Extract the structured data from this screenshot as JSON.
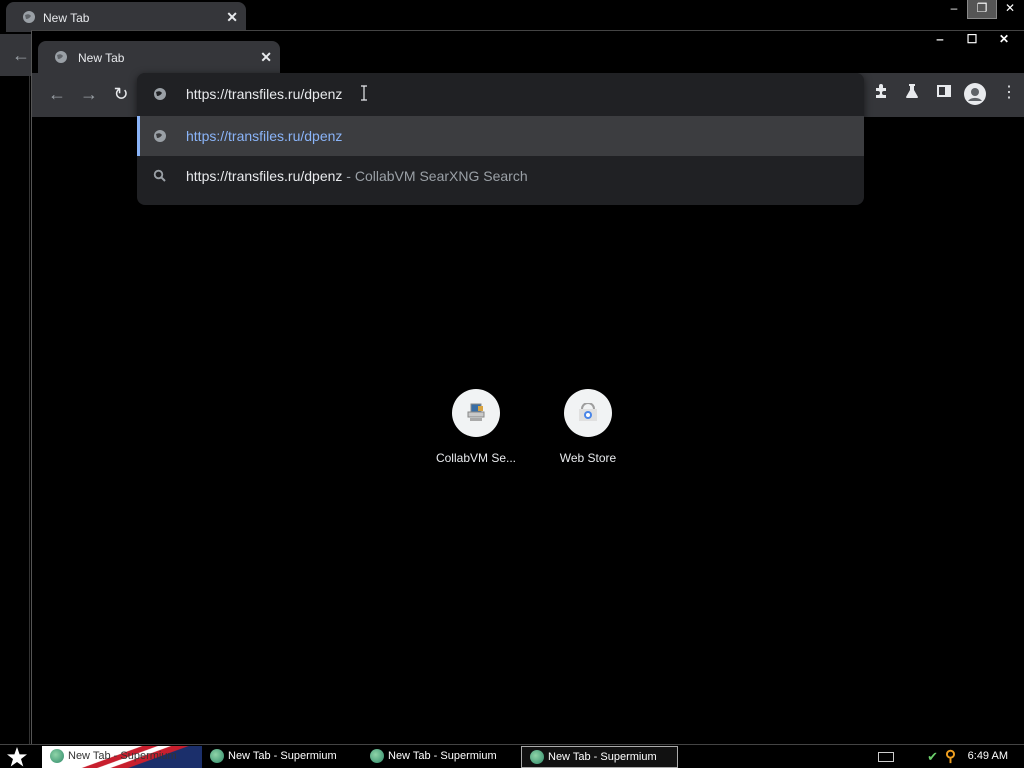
{
  "background_window": {
    "tab_title": "New Tab",
    "tab_close": "✕",
    "controls": {
      "minimize": "‒",
      "restore": "❐",
      "close": "✕"
    }
  },
  "window": {
    "tab_title": "New Tab",
    "tab_close": "✕",
    "controls": {
      "minimize": "‒",
      "maximize": "☐",
      "close": "✕"
    }
  },
  "toolbar": {
    "back": "←",
    "forward": "→",
    "reload": "↻",
    "extensions": "puzzle-icon",
    "labs": "flask-icon",
    "side_panel": "side-panel-icon",
    "profile": "avatar-icon",
    "menu": "⋮"
  },
  "omnibox": {
    "input_value": "https://transfiles.ru/dpenz",
    "suggestions": [
      {
        "text": "https://transfiles.ru/dpenz",
        "description": "",
        "icon": "globe-icon"
      },
      {
        "text": "https://transfiles.ru/dpenz",
        "description": " - CollabVM SearXNG Search",
        "icon": "search-icon"
      }
    ]
  },
  "shortcuts": [
    {
      "label": "CollabVM Se...",
      "icon": "computer-icon"
    },
    {
      "label": "Web Store",
      "icon": "web-store-icon"
    }
  ],
  "taskbar": {
    "start_icon": "star-icon",
    "tasks": [
      {
        "label": "New Tab - Supermium"
      },
      {
        "label": "New Tab - Supermium"
      },
      {
        "label": "New Tab - Supermium"
      },
      {
        "label": "New Tab - Supermium"
      }
    ],
    "clock": "6:49 AM"
  },
  "colors": {
    "toolbar_bg": "#35363a",
    "omnibox_bg": "#202124",
    "link_blue": "#8ab4f8",
    "selected_row": "#3c3d40"
  }
}
